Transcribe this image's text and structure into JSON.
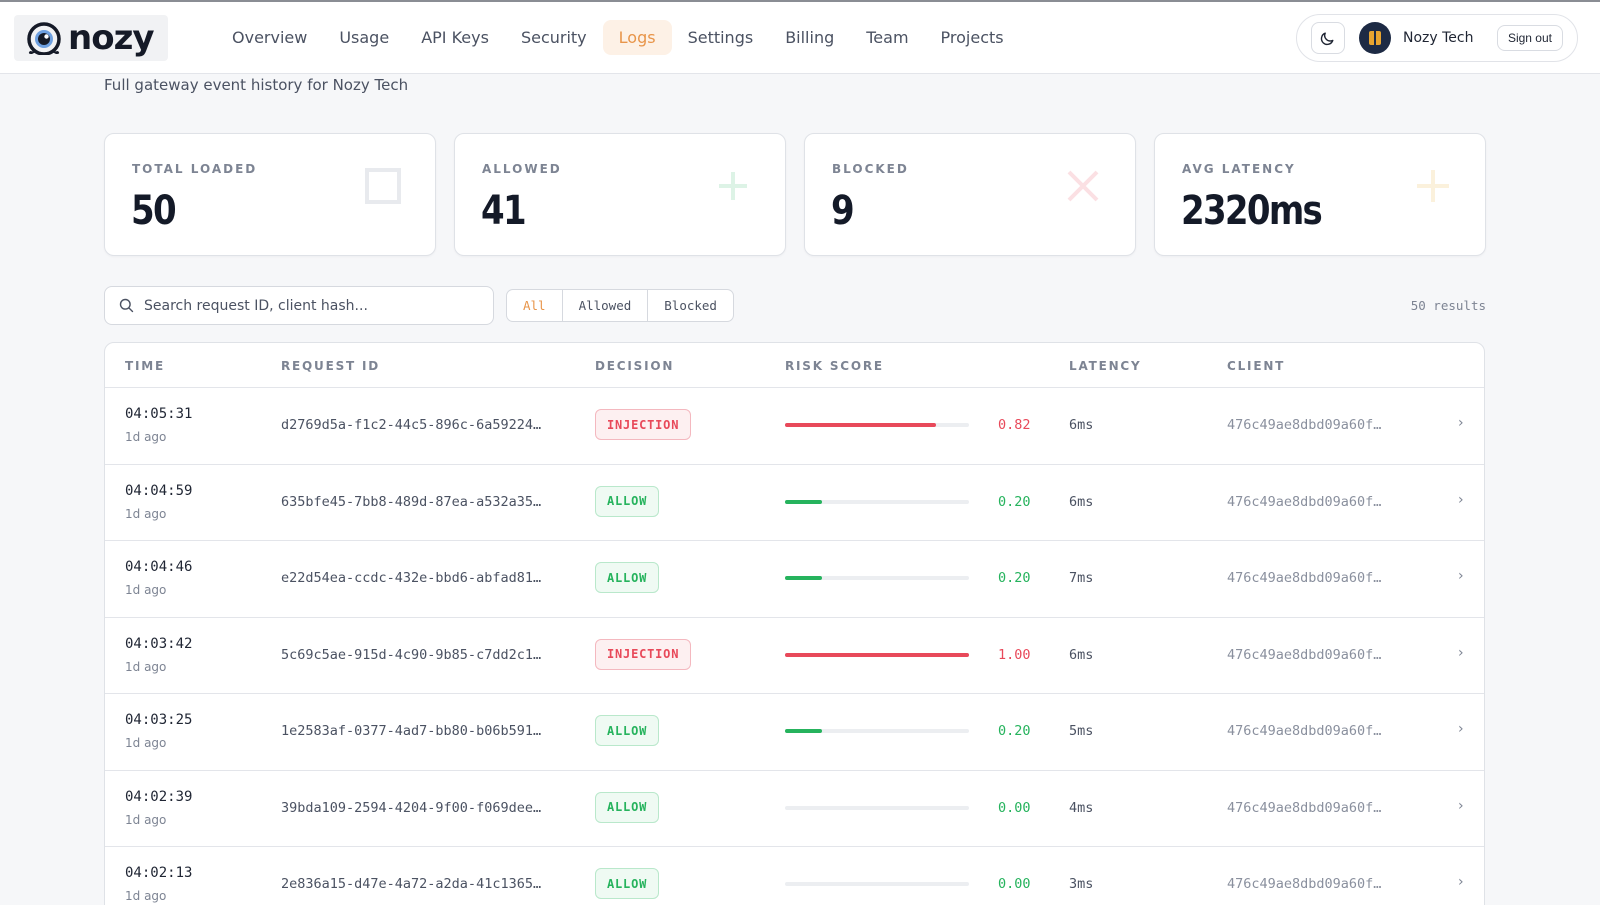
{
  "app": {
    "logo_text": "nozy",
    "logo_icon": "eye-logo-icon"
  },
  "nav": {
    "items": [
      {
        "label": "Overview",
        "active": false
      },
      {
        "label": "Usage",
        "active": false
      },
      {
        "label": "API Keys",
        "active": false
      },
      {
        "label": "Security",
        "active": false
      },
      {
        "label": "Logs",
        "active": true
      },
      {
        "label": "Settings",
        "active": false
      },
      {
        "label": "Billing",
        "active": false
      },
      {
        "label": "Team",
        "active": false
      },
      {
        "label": "Projects",
        "active": false
      }
    ]
  },
  "user": {
    "theme_icon": "moon-icon",
    "name": "Nozy Tech",
    "sign_out_label": "Sign out"
  },
  "page": {
    "subtitle": "Full gateway event history for Nozy Tech"
  },
  "stats": [
    {
      "label": "TOTAL LOADED",
      "value": "50",
      "icon": "square-icon",
      "icon_color": "#e8eaee"
    },
    {
      "label": "ALLOWED",
      "value": "41",
      "icon": "plus-icon",
      "icon_color": "#ddf3e6"
    },
    {
      "label": "BLOCKED",
      "value": "9",
      "icon": "x-icon",
      "icon_color": "#fbe0e3"
    },
    {
      "label": "AVG LATENCY",
      "value": "2320ms",
      "icon": "sparkle-icon",
      "icon_color": "#fbf1dc"
    }
  ],
  "search": {
    "placeholder": "Search request ID, client hash...",
    "value": ""
  },
  "filters": {
    "options": [
      "All",
      "Allowed",
      "Blocked"
    ],
    "selected": "All"
  },
  "results": {
    "label": "50 results"
  },
  "table": {
    "headers": {
      "time": "TIME",
      "request_id": "REQUEST ID",
      "decision": "DECISION",
      "risk_score": "RISK SCORE",
      "latency": "LATENCY",
      "client": "CLIENT"
    },
    "rows": [
      {
        "time": "04:05:31",
        "ago": "1d ago",
        "request_id": "d2769d5a-f1c2-44c5-896c-6a59224…",
        "decision": "INJECTION",
        "risk": 0.82,
        "risk_label": "0.82",
        "latency": "6ms",
        "client": "476c49ae8dbd09a60f…"
      },
      {
        "time": "04:04:59",
        "ago": "1d ago",
        "request_id": "635bfe45-7bb8-489d-87ea-a532a35…",
        "decision": "ALLOW",
        "risk": 0.2,
        "risk_label": "0.20",
        "latency": "6ms",
        "client": "476c49ae8dbd09a60f…"
      },
      {
        "time": "04:04:46",
        "ago": "1d ago",
        "request_id": "e22d54ea-ccdc-432e-bbd6-abfad81…",
        "decision": "ALLOW",
        "risk": 0.2,
        "risk_label": "0.20",
        "latency": "7ms",
        "client": "476c49ae8dbd09a60f…"
      },
      {
        "time": "04:03:42",
        "ago": "1d ago",
        "request_id": "5c69c5ae-915d-4c90-9b85-c7dd2c1…",
        "decision": "INJECTION",
        "risk": 1.0,
        "risk_label": "1.00",
        "latency": "6ms",
        "client": "476c49ae8dbd09a60f…"
      },
      {
        "time": "04:03:25",
        "ago": "1d ago",
        "request_id": "1e2583af-0377-4ad7-bb80-b06b591…",
        "decision": "ALLOW",
        "risk": 0.2,
        "risk_label": "0.20",
        "latency": "5ms",
        "client": "476c49ae8dbd09a60f…"
      },
      {
        "time": "04:02:39",
        "ago": "1d ago",
        "request_id": "39bda109-2594-4204-9f00-f069dee…",
        "decision": "ALLOW",
        "risk": 0.0,
        "risk_label": "0.00",
        "latency": "4ms",
        "client": "476c49ae8dbd09a60f…"
      },
      {
        "time": "04:02:13",
        "ago": "1d ago",
        "request_id": "2e836a15-d47e-4a72-a2da-41c1365…",
        "decision": "ALLOW",
        "risk": 0.0,
        "risk_label": "0.00",
        "latency": "3ms",
        "client": "476c49ae8dbd09a60f…"
      }
    ]
  },
  "colors": {
    "accent": "#e8954a",
    "danger": "#e8495a",
    "success": "#26b35d"
  }
}
